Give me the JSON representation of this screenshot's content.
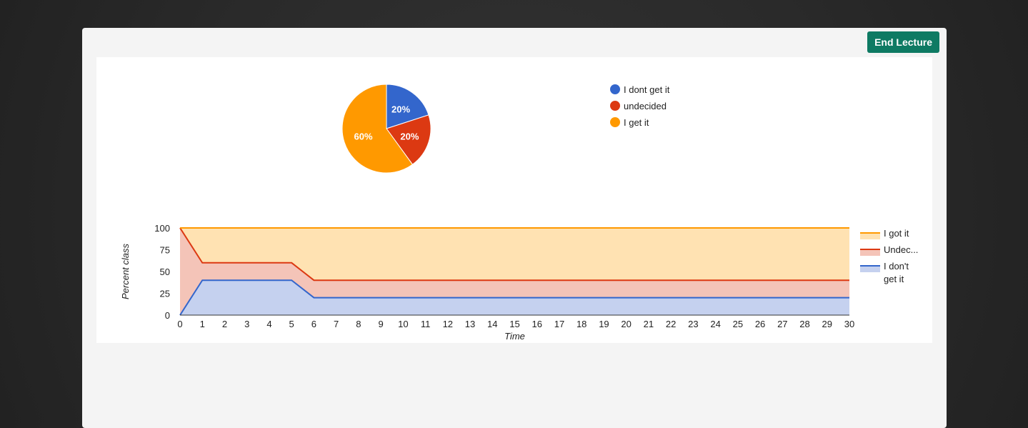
{
  "toolbar": {
    "end_label": "End Lecture"
  },
  "colors": {
    "blue": "#3366cc",
    "red": "#dc3912",
    "orange": "#ff9900",
    "button": "#0e7a63"
  },
  "chart_data": [
    {
      "type": "pie",
      "title": "",
      "slices": [
        {
          "label": "I dont get it",
          "value": 20,
          "color": "#3366cc",
          "text": "20%"
        },
        {
          "label": "undecided",
          "value": 20,
          "color": "#dc3912",
          "text": "20%"
        },
        {
          "label": "I get it",
          "value": 60,
          "color": "#ff9900",
          "text": "60%"
        }
      ],
      "legend": "right"
    },
    {
      "type": "area",
      "stacked": true,
      "xlabel": "Time",
      "ylabel": "Percent class",
      "x": [
        0,
        1,
        2,
        3,
        4,
        5,
        6,
        7,
        8,
        9,
        10,
        11,
        12,
        13,
        14,
        15,
        16,
        17,
        18,
        19,
        20,
        21,
        22,
        23,
        24,
        25,
        26,
        27,
        28,
        29,
        30
      ],
      "ylim": [
        0,
        100
      ],
      "yticks": [
        0,
        25,
        50,
        75,
        100
      ],
      "series": [
        {
          "name": "I don't get it",
          "color": "#3366cc",
          "values": [
            0,
            40,
            40,
            40,
            40,
            40,
            20,
            20,
            20,
            20,
            20,
            20,
            20,
            20,
            20,
            20,
            20,
            20,
            20,
            20,
            20,
            20,
            20,
            20,
            20,
            20,
            20,
            20,
            20,
            20,
            20
          ]
        },
        {
          "name": "Undec...",
          "color": "#dc3912",
          "values": [
            100,
            20,
            20,
            20,
            20,
            20,
            20,
            20,
            20,
            20,
            20,
            20,
            20,
            20,
            20,
            20,
            20,
            20,
            20,
            20,
            20,
            20,
            20,
            20,
            20,
            20,
            20,
            20,
            20,
            20,
            20
          ]
        },
        {
          "name": "I got it",
          "color": "#ff9900",
          "values": [
            0,
            40,
            40,
            40,
            40,
            40,
            60,
            60,
            60,
            60,
            60,
            60,
            60,
            60,
            60,
            60,
            60,
            60,
            60,
            60,
            60,
            60,
            60,
            60,
            60,
            60,
            60,
            60,
            60,
            60,
            60
          ]
        }
      ],
      "legend_entries": [
        {
          "text": [
            "I got it"
          ],
          "color": "#ff9900"
        },
        {
          "text": [
            "Undec..."
          ],
          "color": "#dc3912"
        },
        {
          "text": [
            "I don't",
            "get it"
          ],
          "color": "#3366cc"
        }
      ],
      "legend": "right",
      "grid": true
    }
  ]
}
